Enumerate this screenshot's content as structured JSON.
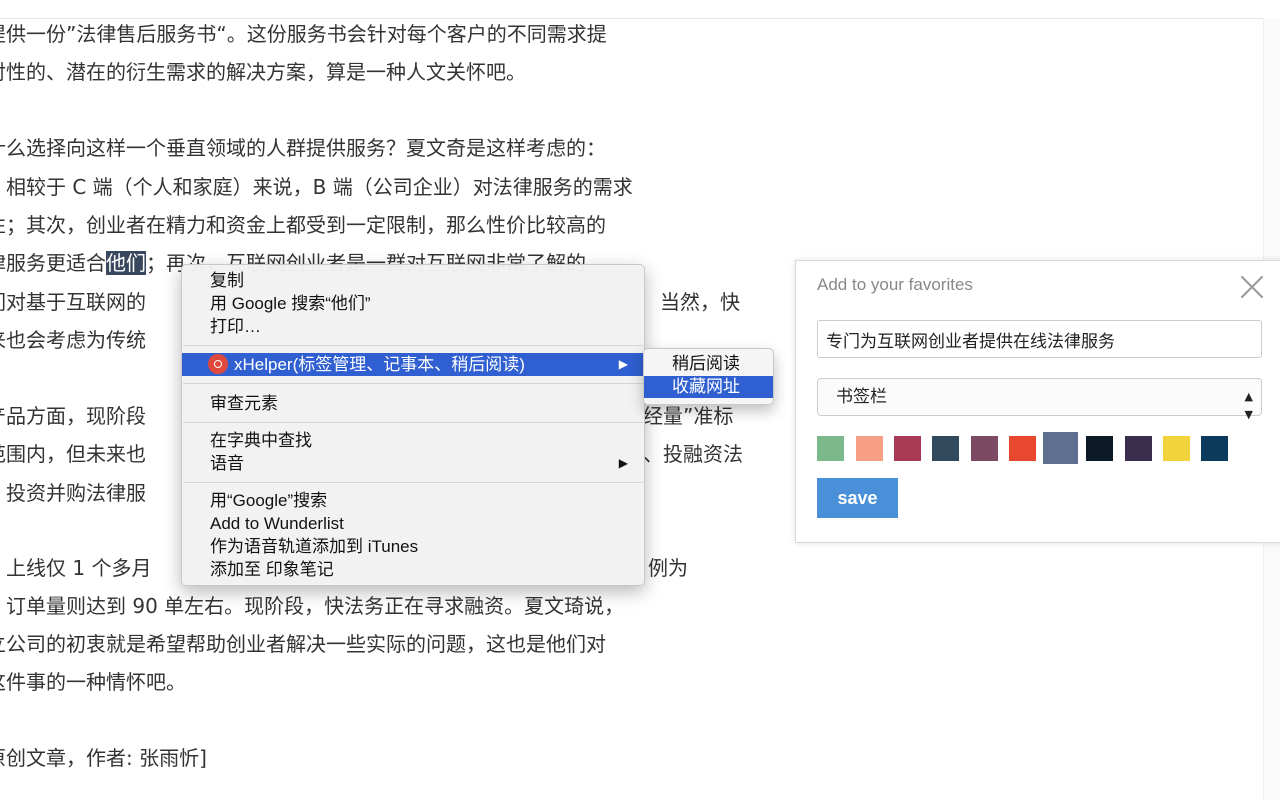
{
  "article": {
    "lines": [
      "提供一份”法律售后服务书“。这份服务书会针对每个客户的不同需求提",
      "对性的、潜在的衍生需求的解决方案，算是一种人文关怀吧。",
      "什么选择向这样一个垂直领域的人群提供服务？夏文奇是这样考虑的：",
      "相较于 C 端（个人和家庭）来说，B 端（公司企业）对法律服务的需求",
      "性；其次，创业者在精力和资金上都受到一定限制，那么性价比较高的",
      "律服务更适合",
      "他们",
      "；再次，互联网创业者是一群对互联网非常了解的",
      "们对基于互联网的",
      "当然，快",
      "来也会考虑为传统",
      "产品方面，现阶段",
      "经量”准标",
      "范围内，但未来也",
      "、投融资法",
      "、投资并购法律服",
      "上线仅 1 个多月",
      "例为",
      "订单量则达到 90 单左右。现阶段，快法务正在寻求融资。夏文琦说，",
      "立公司的初衷就是希望帮助创业者解决一些实际的问题，这也是他们对",
      "这件事的一种情怀吧。",
      "原创文章，作者: 张雨忻]"
    ]
  },
  "context_menu": {
    "items": [
      "复制",
      "用 Google 搜索“他们”",
      "打印…",
      "xHelper(标签管理、记事本、稍后阅读)",
      "审查元素",
      "在字典中查找",
      "语音",
      "用“Google”搜索",
      "Add to Wunderlist",
      "作为语音轨道添加到 iTunes",
      "添加至 印象笔记"
    ],
    "submenu_arrow": "▶",
    "xhelper_icon": "xhelper-icon"
  },
  "submenu": {
    "items": [
      "稍后阅读",
      "收藏网址"
    ]
  },
  "favorites": {
    "title": "Add to your favorites",
    "title_input_value": "专门为互联网创业者提供在线法律服务",
    "folder_selected": "书签栏",
    "select_caret": "▲▼",
    "colors": [
      "#7bb88a",
      "#f79f85",
      "#a83a55",
      "#314a5d",
      "#7d4a64",
      "#e8492e",
      "#5f6f8f",
      "#0b1a26",
      "#3b2d4d",
      "#f2d33b",
      "#0c3a5c"
    ],
    "selected_color": "#5f6f8f",
    "save_label": "save"
  }
}
